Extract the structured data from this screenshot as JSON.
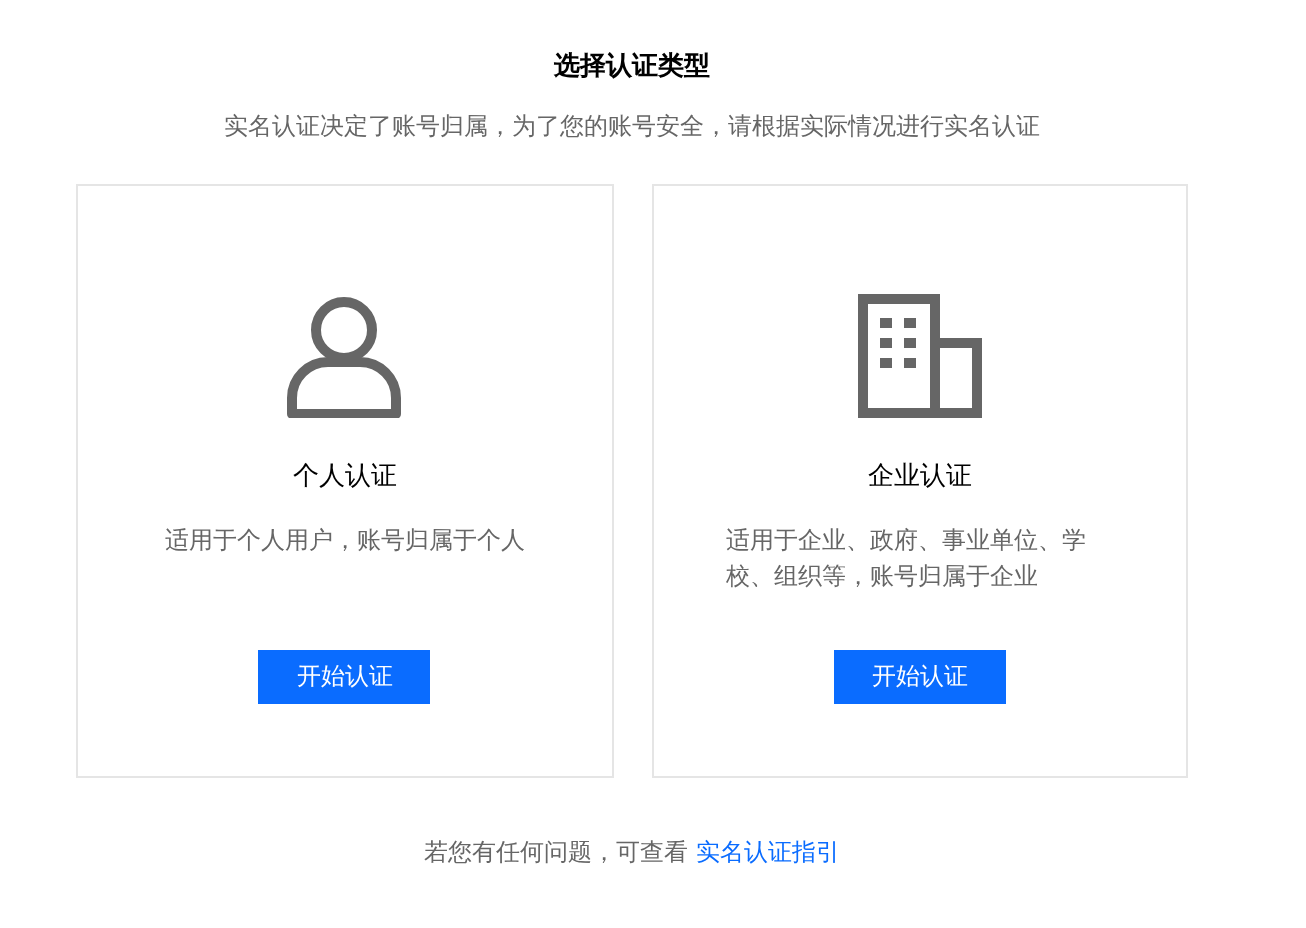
{
  "title": "选择认证类型",
  "subtitle": "实名认证决定了账号归属，为了您的账号安全，请根据实际情况进行实名认证",
  "cards": [
    {
      "kind": "person",
      "title": "个人认证",
      "description": "适用于个人用户，账号归属于个人",
      "button": "开始认证"
    },
    {
      "kind": "company",
      "title": "企业认证",
      "description": "适用于企业、政府、事业单位、学校、组织等，账号归属于企业",
      "button": "开始认证"
    }
  ],
  "footer": {
    "text": "若您有任何问题，可查看",
    "link": "实名认证指引"
  }
}
